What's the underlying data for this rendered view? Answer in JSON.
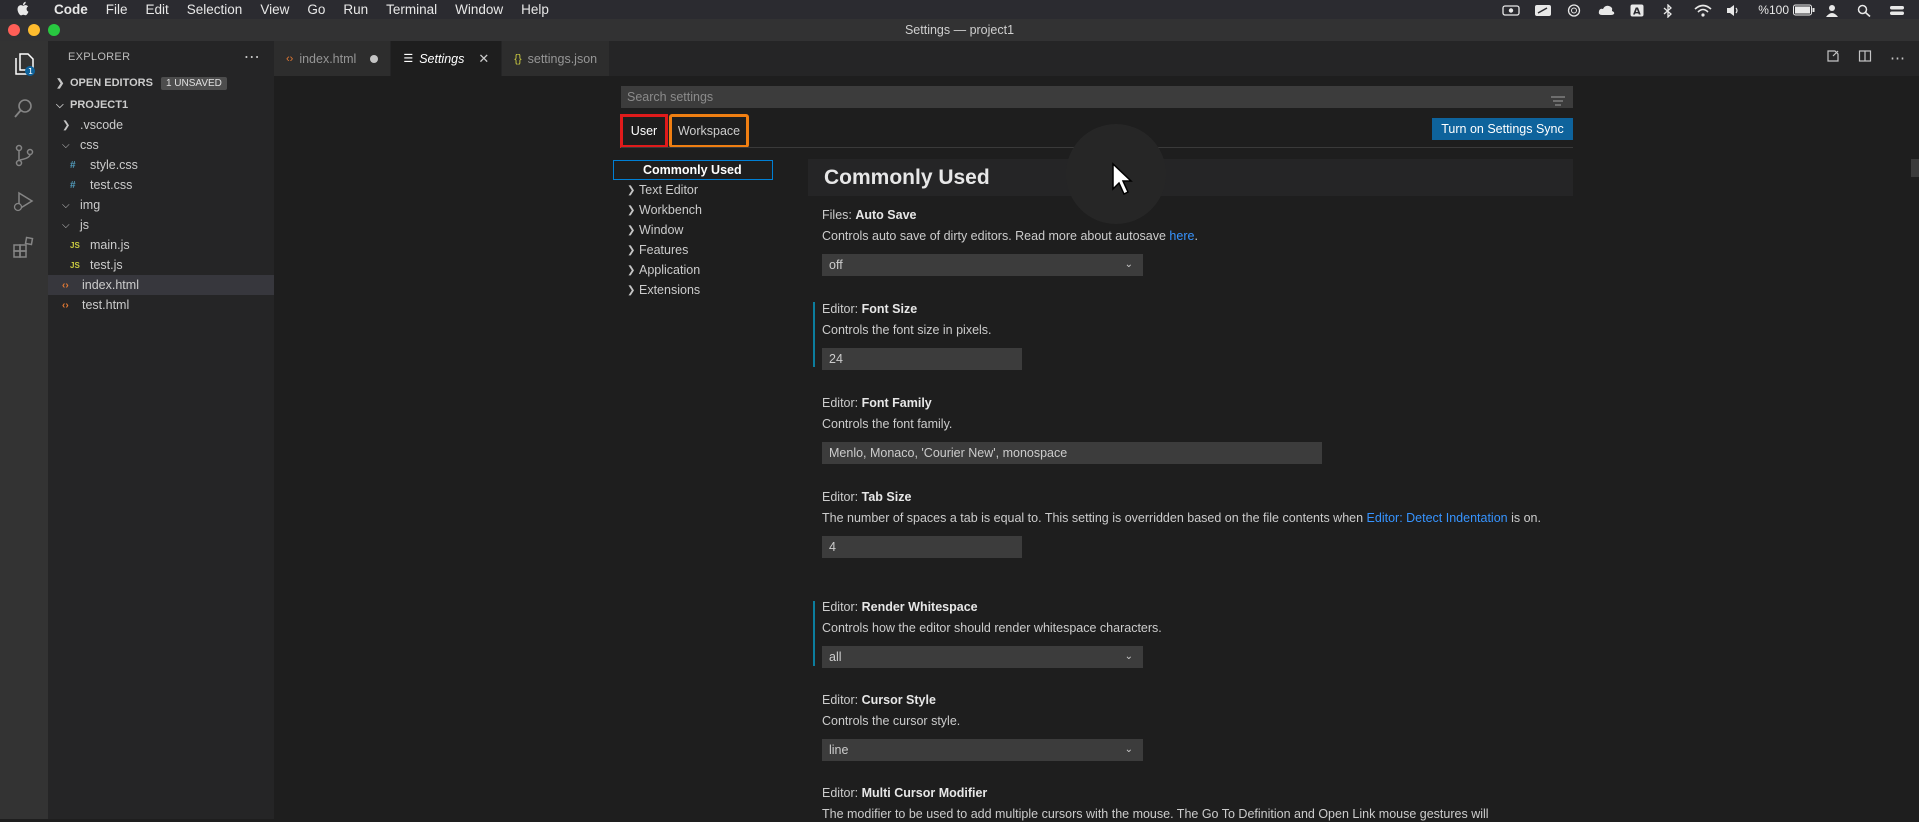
{
  "menubar": {
    "app": "Code",
    "items": [
      "File",
      "Edit",
      "Selection",
      "View",
      "Go",
      "Run",
      "Terminal",
      "Window",
      "Help"
    ],
    "battery": "%100"
  },
  "window": {
    "title": "Settings — project1"
  },
  "sidebar": {
    "header": "EXPLORER",
    "open_editors": {
      "label": "OPEN EDITORS",
      "badge": "1 UNSAVED"
    },
    "project": "PROJECT1",
    "tree": [
      {
        "label": ".vscode",
        "kind": "folder-closed",
        "indent": 1
      },
      {
        "label": "css",
        "kind": "folder-open",
        "indent": 1
      },
      {
        "label": "style.css",
        "kind": "css",
        "indent": 2
      },
      {
        "label": "test.css",
        "kind": "css",
        "indent": 2
      },
      {
        "label": "img",
        "kind": "folder-open",
        "indent": 1
      },
      {
        "label": "js",
        "kind": "folder-open",
        "indent": 1
      },
      {
        "label": "main.js",
        "kind": "js",
        "indent": 2
      },
      {
        "label": "test.js",
        "kind": "js",
        "indent": 2
      },
      {
        "label": "index.html",
        "kind": "html",
        "indent": 1,
        "selected": true
      },
      {
        "label": "test.html",
        "kind": "html",
        "indent": 1
      }
    ]
  },
  "tabs": [
    {
      "label": "index.html",
      "icon": "html-icon",
      "state": "dirty"
    },
    {
      "label": "Settings",
      "icon": "settings-icon",
      "state": "active"
    },
    {
      "label": "settings.json",
      "icon": "json-icon",
      "state": "normal"
    }
  ],
  "settings": {
    "search_placeholder": "Search settings",
    "scope_user": "User",
    "scope_workspace": "Workspace",
    "sync_button": "Turn on Settings Sync",
    "toc": [
      "Commonly Used",
      "Text Editor",
      "Workbench",
      "Window",
      "Features",
      "Application",
      "Extensions"
    ],
    "category": "Commonly Used",
    "items": {
      "auto_save": {
        "prefix": "Files: ",
        "name": "Auto Save",
        "desc": "Controls auto save of dirty editors. Read more about autosave ",
        "link": "here",
        "desc_end": ".",
        "value": "off"
      },
      "font_size": {
        "prefix": "Editor: ",
        "name": "Font Size",
        "desc": "Controls the font size in pixels.",
        "value": "24"
      },
      "font_family": {
        "prefix": "Editor: ",
        "name": "Font Family",
        "desc": "Controls the font family.",
        "value": "Menlo, Monaco, 'Courier New', monospace"
      },
      "tab_size": {
        "prefix": "Editor: ",
        "name": "Tab Size",
        "desc": "The number of spaces a tab is equal to. This setting is overridden based on the file contents when ",
        "link": "Editor: Detect Indentation",
        "desc_end": " is on.",
        "value": "4"
      },
      "render_whitespace": {
        "prefix": "Editor: ",
        "name": "Render Whitespace",
        "desc": "Controls how the editor should render whitespace characters.",
        "value": "all"
      },
      "cursor_style": {
        "prefix": "Editor: ",
        "name": "Cursor Style",
        "desc": "Controls the cursor style.",
        "value": "line"
      },
      "multi_cursor": {
        "prefix": "Editor: ",
        "name": "Multi Cursor Modifier",
        "desc": "The modifier to be used to add multiple cursors with the mouse. The Go To Definition and Open Link mouse gestures will"
      }
    }
  },
  "colors": {
    "accent_blue": "#0e639c",
    "link": "#3794ff",
    "user_outline": "#e01b1b",
    "workspace_outline": "#f07f12"
  }
}
